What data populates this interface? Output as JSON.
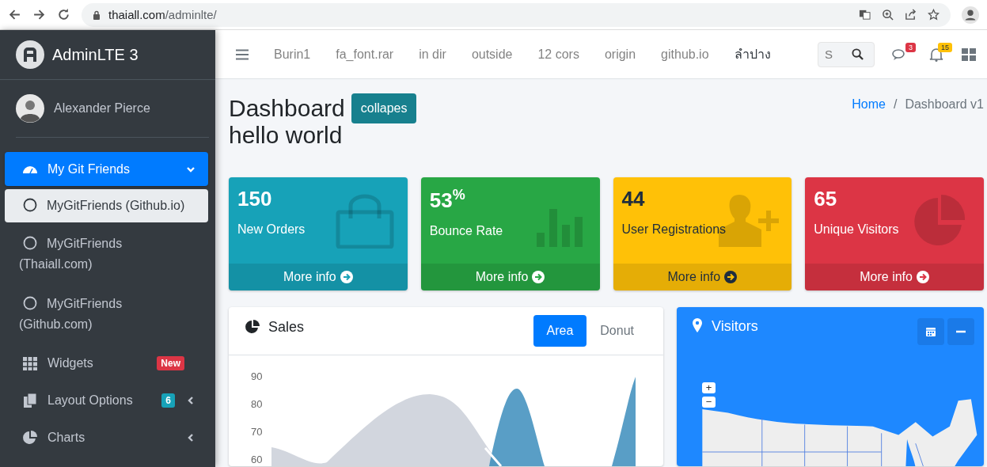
{
  "browser": {
    "url_host": "thaiall.com",
    "url_path": "/adminlte/"
  },
  "sidebar": {
    "brand": "AdminLTE 3",
    "user": "Alexander Pierce",
    "items": [
      {
        "label": "My Git Friends",
        "kind": "parent",
        "selected": true,
        "expanded": true,
        "children": [
          {
            "label": "MyGitFriends (Github.io)",
            "selected": true
          },
          {
            "label": "MyGitFriends (Thaiall.com)",
            "selected": false
          },
          {
            "label": "MyGitFriends (Github.com)",
            "selected": false
          }
        ]
      },
      {
        "label": "Widgets",
        "kind": "link",
        "selected": false,
        "badge": {
          "label": "New",
          "color": "#dc3545"
        }
      },
      {
        "label": "Layout Options",
        "kind": "parent",
        "selected": false,
        "expanded": false,
        "badge": {
          "label": "6",
          "color": "#17a2b8"
        }
      },
      {
        "label": "Charts",
        "kind": "parent",
        "selected": false,
        "expanded": false
      }
    ]
  },
  "navbar": {
    "links": [
      "Burin1",
      "fa_font.rar",
      "in dir",
      "outside",
      "12 cors",
      "origin",
      "github.io",
      "ลำปาง"
    ],
    "search": {
      "placeholder": "S"
    },
    "messages_badge": {
      "count": "3",
      "color": "#dc3545"
    },
    "notifications_badge": {
      "count": "15",
      "color": "#ffc107"
    }
  },
  "header": {
    "title": "Dashboard",
    "button": "collapes",
    "subtitle": "hello world",
    "breadcrumb": [
      {
        "label": "Home",
        "active": false
      },
      {
        "label": "Dashboard v1",
        "active": true
      }
    ],
    "separator": "/"
  },
  "boxes": [
    {
      "value": "150",
      "label": "New Orders",
      "footer": "More info",
      "color": "#17a2b8",
      "kind": "bag",
      "dark_text": false
    },
    {
      "value": "53",
      "sup": "%",
      "label": "Bounce Rate",
      "footer": "More info",
      "color": "#28a745",
      "kind": "bars",
      "dark_text": false
    },
    {
      "value": "44",
      "label": "User Registrations",
      "footer": "More info",
      "color": "#ffc107",
      "kind": "user",
      "dark_text": true
    },
    {
      "value": "65",
      "label": "Unique Visitors",
      "footer": "More info",
      "color": "#dc3545",
      "kind": "pie",
      "dark_text": false
    }
  ],
  "sales": {
    "title": "Sales",
    "tabs": [
      {
        "label": "Area",
        "selected": true
      },
      {
        "label": "Donut",
        "selected": false
      }
    ],
    "y_ticks": [
      "90",
      "80",
      "70",
      "60"
    ]
  },
  "visitors": {
    "title": "Visitors",
    "zoom_in": "+",
    "zoom_out": "−"
  }
}
